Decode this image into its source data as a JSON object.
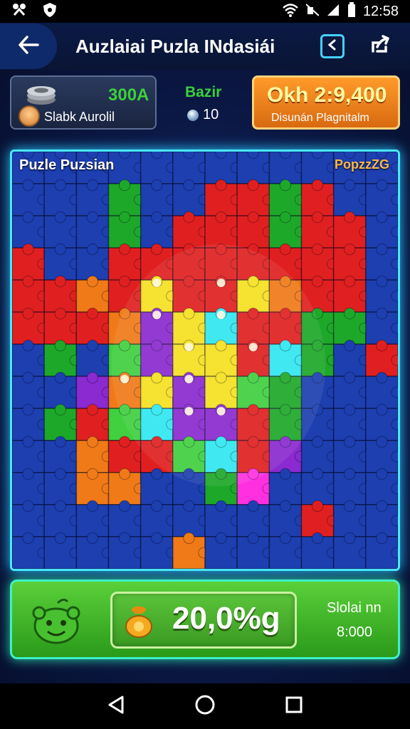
{
  "status_bar": {
    "time": "12:58",
    "icons": [
      "scissors-icon",
      "shield-icon",
      "wifi-icon",
      "mute-icon",
      "signal-icon",
      "battery-icon"
    ]
  },
  "app_bar": {
    "title": "Auzlaiai Puzla INdasiái",
    "icons": [
      "back-arrow-icon",
      "collapse-panel-icon",
      "share-icon"
    ],
    "accent": "#45d0ff"
  },
  "player": {
    "score": "300A",
    "name": "Slabk Aurolil"
  },
  "mid_stats": {
    "label": "Bazir",
    "value": "10"
  },
  "score_card": {
    "title": "Okh 2:9,400",
    "subtitle": "Disunán Plagnitalm"
  },
  "board": {
    "title": "Puzle Puzsian",
    "tag": "PopzzZG"
  },
  "bottom": {
    "progress": "20,0%g",
    "side_label": "Slolai nn",
    "side_value": "8:000"
  },
  "nav": {
    "icons": [
      "back-triangle-icon",
      "home-circle-icon",
      "recents-square-icon"
    ]
  },
  "colors": {
    "board_glow": "#4ae8ff",
    "score_card": "#ff9a2a",
    "panel_green": "#5ad03a"
  }
}
